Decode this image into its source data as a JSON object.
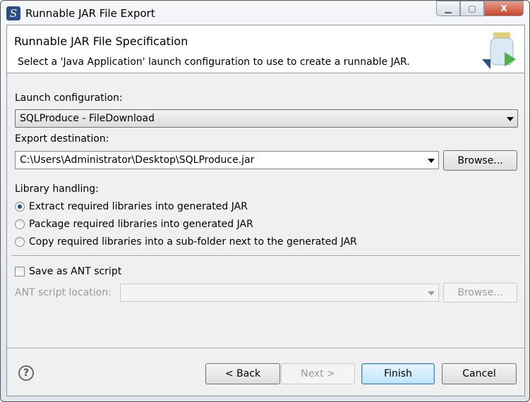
{
  "window": {
    "title": "Runnable JAR File Export",
    "min_icon": "minimize-icon",
    "max_icon": "maximize-icon",
    "close_label": "X"
  },
  "header": {
    "title": "Runnable JAR File Specification",
    "description": "Select a 'Java Application' launch configuration to use to create a runnable JAR.",
    "icon": "jar-export-icon"
  },
  "launch": {
    "label": "Launch configuration:",
    "value": "SQLProduce - FileDownload"
  },
  "destination": {
    "label": "Export destination:",
    "value": "C:\\Users\\Administrator\\Desktop\\SQLProduce.jar",
    "browse": "Browse..."
  },
  "library": {
    "label": "Library handling:",
    "options": [
      {
        "label": "Extract required libraries into generated JAR",
        "selected": true
      },
      {
        "label": "Package required libraries into generated JAR",
        "selected": false
      },
      {
        "label": "Copy required libraries into a sub-folder next to the generated JAR",
        "selected": false
      }
    ]
  },
  "ant": {
    "checkbox": "Save as ANT script",
    "checked": false,
    "location_label": "ANT script location:",
    "location_value": "",
    "browse": "Browse..."
  },
  "footer": {
    "help": "?",
    "back": "< Back",
    "next": "Next >",
    "finish": "Finish",
    "cancel": "Cancel"
  }
}
